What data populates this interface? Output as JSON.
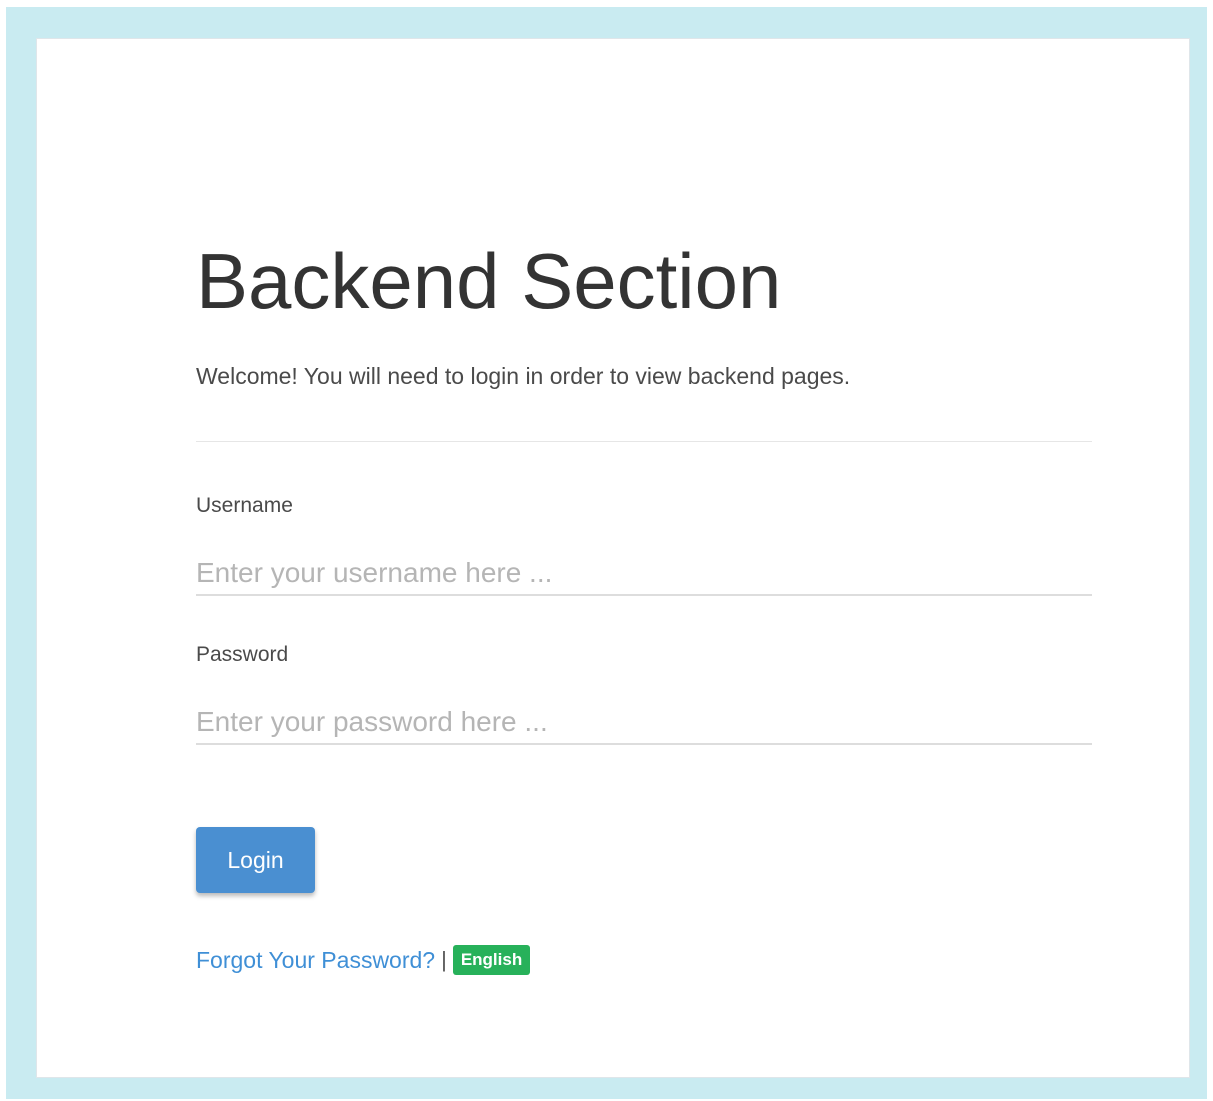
{
  "page": {
    "title": "Backend Section",
    "welcome": "Welcome! You will need to login in order to view backend pages."
  },
  "form": {
    "username_label": "Username",
    "username_placeholder": "Enter your username here ...",
    "username_value": "",
    "password_label": "Password",
    "password_placeholder": "Enter your password here ...",
    "password_value": "",
    "login_label": "Login"
  },
  "footer": {
    "forgot_label": "Forgot Your Password?",
    "separator": "|",
    "language": "English"
  },
  "colors": {
    "frame_background": "#c9ebf1",
    "accent": "#4a8fd1",
    "link": "#3f8fd6",
    "language_badge": "#27b15a"
  }
}
